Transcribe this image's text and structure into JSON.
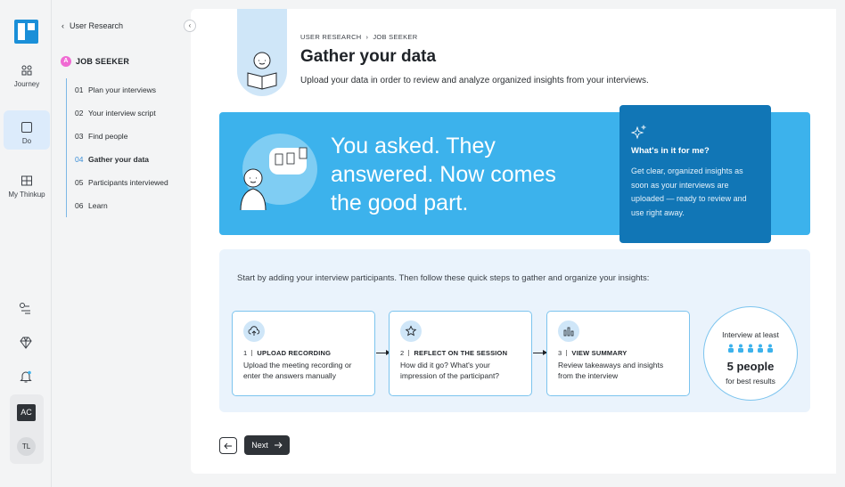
{
  "rail": {
    "items": [
      {
        "label": "Journey",
        "icon": "journey-icon"
      },
      {
        "label": "Do",
        "icon": "do-icon"
      },
      {
        "label": "My Thinkup",
        "icon": "thinkup-icon"
      }
    ],
    "bottom_icons": [
      "connections-icon",
      "diamond-icon",
      "bell-icon"
    ],
    "avatars": [
      "AC",
      "TL"
    ]
  },
  "nav": {
    "back_label": "User Research",
    "persona_badge": "A",
    "persona": "JOB SEEKER",
    "steps": [
      {
        "num": "01",
        "label": "Plan your interviews"
      },
      {
        "num": "02",
        "label": "Your interview script"
      },
      {
        "num": "03",
        "label": "Find people"
      },
      {
        "num": "04",
        "label": "Gather your data"
      },
      {
        "num": "05",
        "label": "Participants interviewed"
      },
      {
        "num": "06",
        "label": "Learn"
      }
    ],
    "current_step": "04"
  },
  "header": {
    "crumb_1": "USER RESEARCH",
    "crumb_2": "JOB SEEKER",
    "title": "Gather your data",
    "subtitle": "Upload your data in order to review and analyze organized insights from your interviews."
  },
  "banner": {
    "headline": "You asked. They answered. Now comes the good part.",
    "callout_title": "What's in it for me?",
    "callout_body": "Get clear, organized insights as soon as your interviews are uploaded — ready to review and use right away."
  },
  "quick_steps": {
    "intro": "Start by adding your interview participants. Then follow these quick steps to gather and organize your insights:",
    "cards": [
      {
        "num": "1",
        "title": "UPLOAD RECORDING",
        "body": "Upload the meeting recording or enter the answers manually",
        "icon": "cloud-upload-icon"
      },
      {
        "num": "2",
        "title": "REFLECT ON THE SESSION",
        "body": "How did it go? What's your impression of the participant?",
        "icon": "star-icon"
      },
      {
        "num": "3",
        "title": "VIEW SUMMARY",
        "body": "Review takeaways and insights from the interview",
        "icon": "bar-chart-icon"
      }
    ],
    "goal": {
      "line1": "Interview at least",
      "count": "5 people",
      "line3": "for best results"
    }
  },
  "footer": {
    "next_label": "Next"
  },
  "colors": {
    "accent": "#3cb2ec",
    "callout": "#1176b6",
    "panel": "#eaf3fc"
  }
}
